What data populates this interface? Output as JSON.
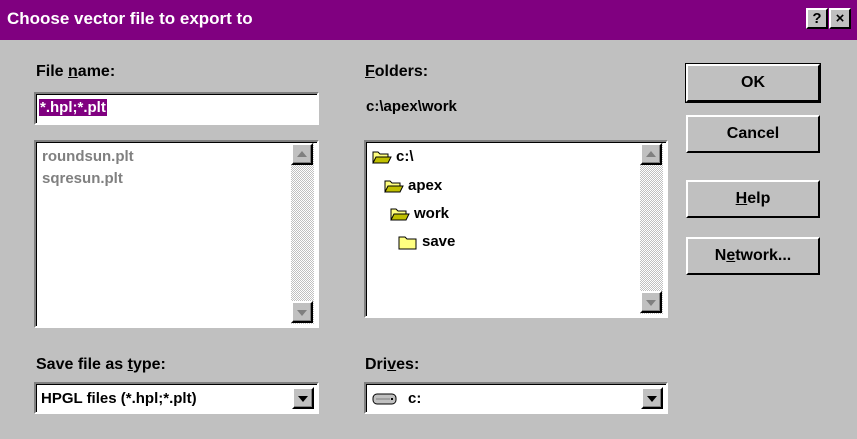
{
  "window": {
    "title": "Choose vector file to export to",
    "help_button": "?",
    "close_button": "×"
  },
  "file_name": {
    "label_pre": "File ",
    "label_mnemonic": "n",
    "label_post": "ame:",
    "value": "*.hpl;*.plt",
    "files": [
      "roundsun.plt",
      "sqresun.plt"
    ]
  },
  "folders": {
    "label_mnemonic": "F",
    "label_post": "olders:",
    "current_path": "c:\\apex\\work",
    "tree": [
      {
        "label": "c:\\",
        "state": "open"
      },
      {
        "label": "apex",
        "state": "open"
      },
      {
        "label": "work",
        "state": "open"
      },
      {
        "label": "save",
        "state": "closed"
      }
    ]
  },
  "save_type": {
    "label_pre": "Save file as ",
    "label_mnemonic": "t",
    "label_post": "ype:",
    "selected": "HPGL files (*.hpl;*.plt)"
  },
  "drives": {
    "label_pre": "Dri",
    "label_mnemonic": "v",
    "label_post": "es:",
    "selected": "c:"
  },
  "buttons": {
    "ok": "OK",
    "cancel": "Cancel",
    "help_mnemonic": "H",
    "help_post": "elp",
    "network_pre": "N",
    "network_mnemonic": "e",
    "network_post": "twork..."
  },
  "colors": {
    "title_bar": "#800080",
    "face": "#c0c0c0",
    "selection": "#800080"
  }
}
